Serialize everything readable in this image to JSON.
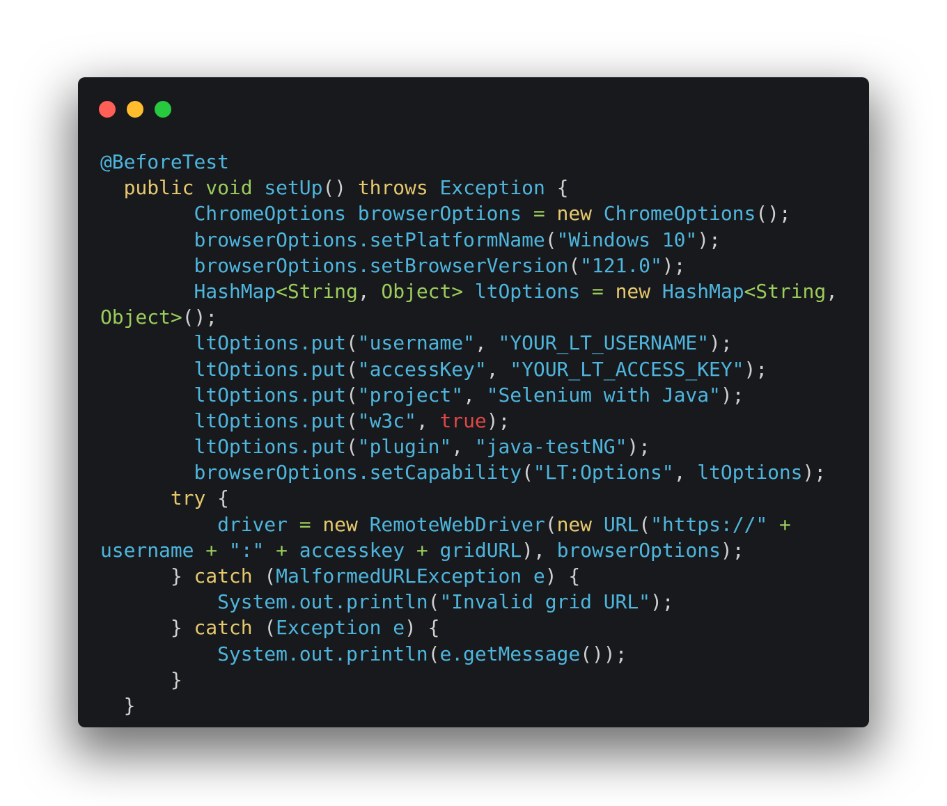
{
  "window": {
    "controls": [
      {
        "name": "close",
        "color": "#ff5f56"
      },
      {
        "name": "minimize",
        "color": "#ffbd2e"
      },
      {
        "name": "zoom",
        "color": "#27c93f"
      }
    ]
  },
  "colors": {
    "background": "#17191c",
    "identifier": "#4fb5dd",
    "keyword": "#e6c86e",
    "type": "#9ccc5c",
    "operator": "#9ccc5c",
    "punctuation": "#d0d0d0",
    "boolean": "#e04848"
  },
  "code": {
    "language": "java",
    "lines": [
      [
        [
          "id",
          "@BeforeTest"
        ]
      ],
      [
        [
          "ws",
          "  "
        ],
        [
          "kw",
          "public"
        ],
        [
          "ws",
          " "
        ],
        [
          "type",
          "void"
        ],
        [
          "ws",
          " "
        ],
        [
          "id",
          "setUp"
        ],
        [
          "punc",
          "()"
        ],
        [
          "ws",
          " "
        ],
        [
          "kw",
          "throws"
        ],
        [
          "ws",
          " "
        ],
        [
          "id",
          "Exception"
        ],
        [
          "ws",
          " "
        ],
        [
          "punc",
          "{"
        ]
      ],
      [
        [
          "ws",
          "        "
        ],
        [
          "id",
          "ChromeOptions browserOptions"
        ],
        [
          "ws",
          " "
        ],
        [
          "op",
          "="
        ],
        [
          "ws",
          " "
        ],
        [
          "kw",
          "new"
        ],
        [
          "ws",
          " "
        ],
        [
          "id",
          "ChromeOptions"
        ],
        [
          "punc",
          "();"
        ]
      ],
      [
        [
          "ws",
          "        "
        ],
        [
          "id",
          "browserOptions.setPlatformName"
        ],
        [
          "punc",
          "("
        ],
        [
          "str",
          "\"Windows 10\""
        ],
        [
          "punc",
          ");"
        ]
      ],
      [
        [
          "ws",
          "        "
        ],
        [
          "id",
          "browserOptions.setBrowserVersion"
        ],
        [
          "punc",
          "("
        ],
        [
          "str",
          "\"121.0\""
        ],
        [
          "punc",
          ");"
        ]
      ],
      [
        [
          "ws",
          "        "
        ],
        [
          "id",
          "HashMap"
        ],
        [
          "type",
          "<String"
        ],
        [
          "punc",
          ", "
        ],
        [
          "type",
          "Object>"
        ],
        [
          "ws",
          " "
        ],
        [
          "id",
          "ltOptions"
        ],
        [
          "ws",
          " "
        ],
        [
          "op",
          "="
        ],
        [
          "ws",
          " "
        ],
        [
          "kw",
          "new"
        ],
        [
          "ws",
          " "
        ],
        [
          "id",
          "HashMap"
        ],
        [
          "type",
          "<String"
        ],
        [
          "punc",
          ","
        ]
      ],
      [
        [
          "type",
          "Object>"
        ],
        [
          "punc",
          "();"
        ]
      ],
      [
        [
          "ws",
          "        "
        ],
        [
          "id",
          "ltOptions.put"
        ],
        [
          "punc",
          "("
        ],
        [
          "str",
          "\"username\""
        ],
        [
          "punc",
          ", "
        ],
        [
          "str",
          "\"YOUR_LT_USERNAME\""
        ],
        [
          "punc",
          ");"
        ]
      ],
      [
        [
          "ws",
          "        "
        ],
        [
          "id",
          "ltOptions.put"
        ],
        [
          "punc",
          "("
        ],
        [
          "str",
          "\"accessKey\""
        ],
        [
          "punc",
          ", "
        ],
        [
          "str",
          "\"YOUR_LT_ACCESS_KEY\""
        ],
        [
          "punc",
          ");"
        ]
      ],
      [
        [
          "ws",
          "        "
        ],
        [
          "id",
          "ltOptions.put"
        ],
        [
          "punc",
          "("
        ],
        [
          "str",
          "\"project\""
        ],
        [
          "punc",
          ", "
        ],
        [
          "str",
          "\"Selenium with Java\""
        ],
        [
          "punc",
          ");"
        ]
      ],
      [
        [
          "ws",
          "        "
        ],
        [
          "id",
          "ltOptions.put"
        ],
        [
          "punc",
          "("
        ],
        [
          "str",
          "\"w3c\""
        ],
        [
          "punc",
          ", "
        ],
        [
          "bool",
          "true"
        ],
        [
          "punc",
          ");"
        ]
      ],
      [
        [
          "ws",
          "        "
        ],
        [
          "id",
          "ltOptions.put"
        ],
        [
          "punc",
          "("
        ],
        [
          "str",
          "\"plugin\""
        ],
        [
          "punc",
          ", "
        ],
        [
          "str",
          "\"java-testNG\""
        ],
        [
          "punc",
          ");"
        ]
      ],
      [
        [
          "ws",
          "        "
        ],
        [
          "id",
          "browserOptions.setCapability"
        ],
        [
          "punc",
          "("
        ],
        [
          "str",
          "\"LT:Options\""
        ],
        [
          "punc",
          ", "
        ],
        [
          "id",
          "ltOptions"
        ],
        [
          "punc",
          ");"
        ]
      ],
      [
        [
          "ws",
          "      "
        ],
        [
          "kw",
          "try"
        ],
        [
          "ws",
          " "
        ],
        [
          "punc",
          "{"
        ]
      ],
      [
        [
          "ws",
          "          "
        ],
        [
          "id",
          "driver"
        ],
        [
          "ws",
          " "
        ],
        [
          "op",
          "="
        ],
        [
          "ws",
          " "
        ],
        [
          "kw",
          "new"
        ],
        [
          "ws",
          " "
        ],
        [
          "id",
          "RemoteWebDriver"
        ],
        [
          "punc",
          "("
        ],
        [
          "kw",
          "new"
        ],
        [
          "ws",
          " "
        ],
        [
          "id",
          "URL"
        ],
        [
          "punc",
          "("
        ],
        [
          "str",
          "\"https://\""
        ],
        [
          "ws",
          " "
        ],
        [
          "op",
          "+"
        ]
      ],
      [
        [
          "id",
          "username"
        ],
        [
          "ws",
          " "
        ],
        [
          "op",
          "+"
        ],
        [
          "ws",
          " "
        ],
        [
          "str",
          "\":\""
        ],
        [
          "ws",
          " "
        ],
        [
          "op",
          "+"
        ],
        [
          "ws",
          " "
        ],
        [
          "id",
          "accesskey"
        ],
        [
          "ws",
          " "
        ],
        [
          "op",
          "+"
        ],
        [
          "ws",
          " "
        ],
        [
          "id",
          "gridURL"
        ],
        [
          "punc",
          "), "
        ],
        [
          "id",
          "browserOptions"
        ],
        [
          "punc",
          ");"
        ]
      ],
      [
        [
          "ws",
          "      "
        ],
        [
          "punc",
          "}"
        ],
        [
          "ws",
          " "
        ],
        [
          "kw",
          "catch"
        ],
        [
          "ws",
          " "
        ],
        [
          "punc",
          "("
        ],
        [
          "id",
          "MalformedURLException e"
        ],
        [
          "punc",
          ")"
        ],
        [
          "ws",
          " "
        ],
        [
          "punc",
          "{"
        ]
      ],
      [
        [
          "ws",
          "          "
        ],
        [
          "id",
          "System.out.println"
        ],
        [
          "punc",
          "("
        ],
        [
          "str",
          "\"Invalid grid URL\""
        ],
        [
          "punc",
          ");"
        ]
      ],
      [
        [
          "ws",
          "      "
        ],
        [
          "punc",
          "}"
        ],
        [
          "ws",
          " "
        ],
        [
          "kw",
          "catch"
        ],
        [
          "ws",
          " "
        ],
        [
          "punc",
          "("
        ],
        [
          "id",
          "Exception e"
        ],
        [
          "punc",
          ")"
        ],
        [
          "ws",
          " "
        ],
        [
          "punc",
          "{"
        ]
      ],
      [
        [
          "ws",
          "          "
        ],
        [
          "id",
          "System.out.println"
        ],
        [
          "punc",
          "("
        ],
        [
          "id",
          "e.getMessage"
        ],
        [
          "punc",
          "());"
        ]
      ],
      [
        [
          "ws",
          "      "
        ],
        [
          "punc",
          "}"
        ]
      ],
      [
        [
          "ws",
          "  "
        ],
        [
          "punc",
          "}"
        ]
      ]
    ]
  }
}
